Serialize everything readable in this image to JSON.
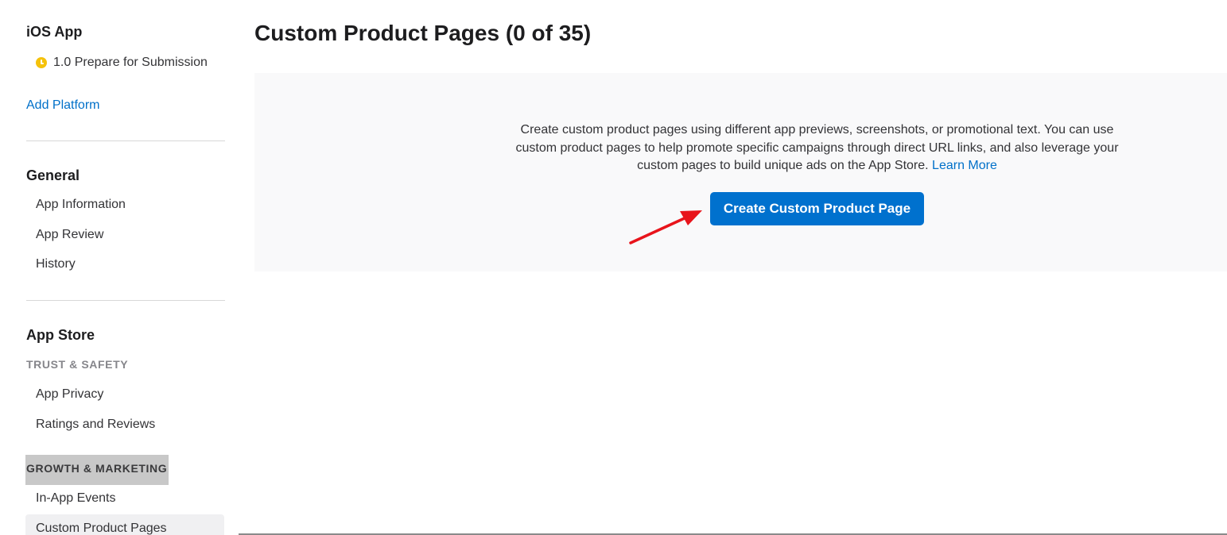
{
  "sidebar": {
    "platform_title": "iOS App",
    "version_label": "1.0 Prepare for Submission",
    "version_status_color": "#f5c20b",
    "add_platform": "Add Platform",
    "general": {
      "title": "General",
      "items": [
        "App Information",
        "App Review",
        "History"
      ]
    },
    "app_store": {
      "title": "App Store",
      "trust_caption": "TRUST & SAFETY",
      "trust_items": [
        "App Privacy",
        "Ratings and Reviews"
      ],
      "growth_caption": "GROWTH & MARKETING",
      "growth_items": [
        "In-App Events",
        "Custom Product Pages"
      ],
      "selected": "Custom Product Pages"
    }
  },
  "main": {
    "title": "Custom Product Pages (0 of 35)",
    "empty_state": {
      "text": "Create custom product pages using different app previews, screenshots, or promotional text. You can use custom product pages to help promote specific campaigns through direct URL links, and also leverage your custom pages to build unique ads on the App Store.",
      "learn_more": "Learn More",
      "button_label": "Create Custom Product Page"
    },
    "annotation": {
      "type": "red-arrow",
      "color": "#e8141b",
      "points_to": "create-custom-product-page-button"
    }
  },
  "colors": {
    "accent": "#0071ce",
    "link": "#0070c9",
    "panel_bg": "#f9f9fa"
  }
}
